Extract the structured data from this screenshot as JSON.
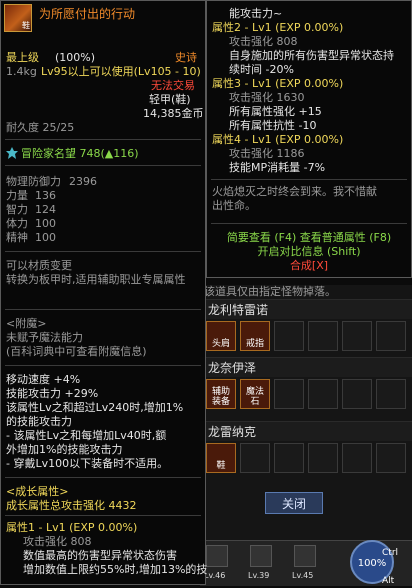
{
  "item": {
    "name": "为所愿付出的行动",
    "icon_label": "鞋",
    "level": "最上级",
    "level_pct": "(100%)",
    "grade": "史诗",
    "weight": "1.4kg",
    "req": "Lv95以上可以使用(Lv105 - 10)",
    "untradeable": "无法交易",
    "type": "轻甲(鞋)",
    "price": "14,385金币",
    "durability": "耐久度 25/25",
    "adventurer_fame": "冒险家名望 748(▲116)",
    "stats": [
      {
        "name": "物理防御力",
        "value": "2396"
      },
      {
        "name": "力量",
        "value": "136"
      },
      {
        "name": "智力",
        "value": "124"
      },
      {
        "name": "体力",
        "value": "100"
      },
      {
        "name": "精神",
        "value": "100"
      }
    ],
    "convertible": "可以材质变更",
    "convert_desc": "转换为板甲时,适用辅助职业专属属性",
    "enchant_header": "<附魔>",
    "enchant_1": "未赋予魔法能力",
    "enchant_2": "(百科词典中可查看附魔信息)",
    "effects": [
      "移动速度 +4%",
      "技能攻击力 +29%",
      "该属性Lv之和超过Lv240时,增加1%",
      "的技能攻击力",
      "- 该属性Lv之和每增加Lv40时,额",
      "外增加1%的技能攻击力",
      "- 穿戴Lv100以下装备时不适用。"
    ],
    "growth_header": "<成长属性>",
    "growth_total": "成长属性总攻击强化 4432",
    "growth_attr1_title": "属性1 - Lv1 (EXP 0.00%)",
    "growth_attr1_atk": "攻击强化 808",
    "growth_attr1_desc_1": "数值最高的伤害型异常状态伤害",
    "growth_attr1_desc_2": "增加数值上限约55%时,增加13%的技"
  },
  "compare": {
    "line_0": "能攻击力~",
    "attr2_title": "属性2 - Lv1 (EXP 0.00%)",
    "attr2_atk": "攻击强化 808",
    "attr2_desc_1": "自身施加的所有伤害型异常状态持",
    "attr2_desc_2": "续时间 -20%",
    "attr3_title": "属性3 - Lv1 (EXP 0.00%)",
    "attr3_atk": "攻击强化 1630",
    "attr3_desc_1": "所有属性强化 +15",
    "attr3_desc_2": "所有属性抗性 -10",
    "attr4_title": "属性4 - Lv1 (EXP 0.00%)",
    "attr4_atk": "攻击强化 1186",
    "attr4_desc_1": "技能MP消耗量 -7%",
    "flavor_1": "火焰熄灭之时终会到来。我不惜献",
    "flavor_2": "出性命。",
    "hint_1": "简要查看 (F4) 查看普通属性 (F8)",
    "hint_2": "开启对比信息 (Shift)",
    "hint_3": "合成[X]"
  },
  "background": {
    "note": "该道具仅由指定怪物掉落。",
    "sets": [
      {
        "name": "龙利特雷诺",
        "slots": [
          "头肩",
          "戒指"
        ]
      },
      {
        "name": "龙奈伊泽",
        "slots": [
          "辅助装备",
          "魔法石"
        ]
      },
      {
        "name": "龙雷纳克",
        "slots": [
          "鞋"
        ]
      }
    ],
    "close_label": "关闭",
    "hud_levels": [
      "Lv.46",
      "Lv.39",
      "Lv.45"
    ],
    "hud_pct": "100%",
    "hud_ctrl": "Ctrl",
    "hud_alt": "Alt"
  },
  "colors": {
    "epic": "#f08a2a",
    "untradeable": "#ff4a3a",
    "growth": "#f0d85a",
    "hint": "#8ad84a",
    "combine": "#ff4a3a"
  }
}
